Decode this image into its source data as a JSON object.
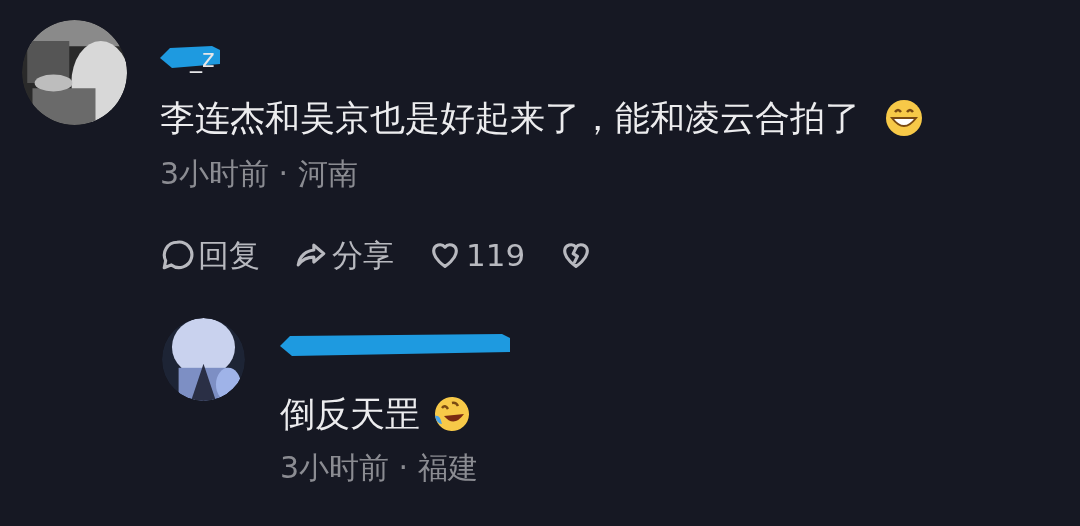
{
  "comment": {
    "username": "_z",
    "name_redacted": true,
    "text": "李连杰和吴京也是好起来了，能和凌云合拍了",
    "emoji": {
      "kind": "grinning"
    },
    "meta": "3小时前 · 河南",
    "actions": [
      {
        "kind": "reply",
        "label": "回复"
      },
      {
        "kind": "share",
        "label": "分享"
      },
      {
        "kind": "like",
        "label": "119"
      },
      {
        "kind": "dislike"
      }
    ],
    "reply": {
      "name_redacted": true,
      "text": "倒反天罡",
      "emoji": {
        "kind": "tears_of_joy"
      },
      "meta": "3小时前 · 福建"
    }
  }
}
